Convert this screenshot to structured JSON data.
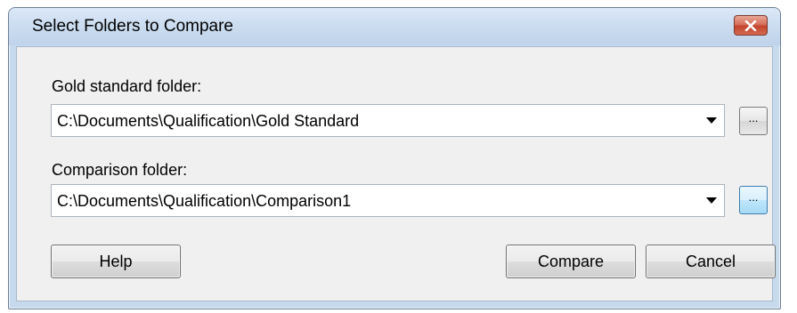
{
  "window": {
    "title": "Select Folders to Compare",
    "close_icon": "close-icon",
    "accent_close": "#c4432d"
  },
  "gold_standard": {
    "label": "Gold standard folder:",
    "value": "C:\\Documents\\Qualification\\Gold Standard",
    "browse_label": "..."
  },
  "comparison": {
    "label": "Comparison folder:",
    "value": "C:\\Documents\\Qualification\\Comparison1",
    "browse_label": "..."
  },
  "buttons": {
    "help": "Help",
    "compare": "Compare",
    "cancel": "Cancel"
  }
}
